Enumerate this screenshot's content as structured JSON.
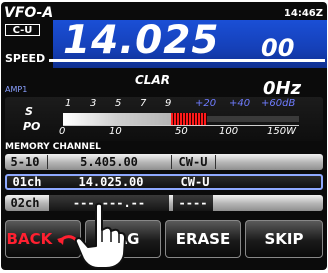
{
  "header": {
    "vfo_label": "VFO-A",
    "mode_badge": "C-U",
    "clock": "14:46Z",
    "frequency_main": "14.025",
    "frequency_small": "00",
    "speed_label": "SPEED"
  },
  "clarifier": {
    "label": "CLAR",
    "offset": "0Hz"
  },
  "meter": {
    "amp_label": "AMP1",
    "s_label": "S",
    "po_label": "PO",
    "s_ticks": [
      "1",
      "3",
      "5",
      "7",
      "9",
      "+20",
      "+40",
      "+60dB"
    ],
    "po_ticks": [
      "0",
      "10",
      "50",
      "100",
      "150W"
    ]
  },
  "memory": {
    "section_title": "MEMORY CHANNEL",
    "rows": [
      {
        "channel": "5-10",
        "frequency": "5.405.00",
        "mode": "CW-U"
      },
      {
        "channel": "01ch",
        "frequency": "14.025.00",
        "mode": "CW-U"
      },
      {
        "channel": "02ch",
        "frequency": "---.---.--",
        "mode": "----"
      }
    ]
  },
  "buttons": {
    "back": "BACK",
    "tag": "TAG",
    "erase": "ERASE",
    "skip": "SKIP"
  },
  "colors": {
    "frequency_background": "#1a4fd6",
    "back_text": "#ff2030",
    "selected_row_border": "#8fa9ff"
  }
}
